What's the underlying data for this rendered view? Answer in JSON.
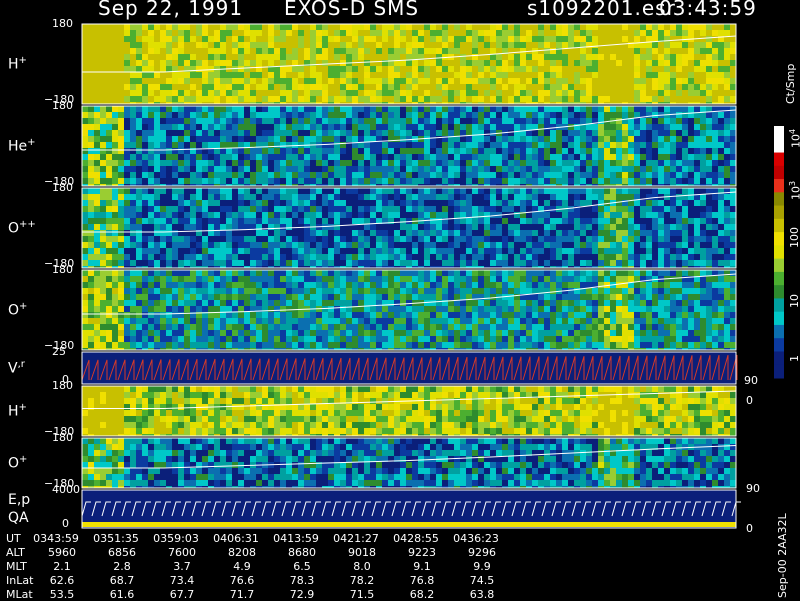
{
  "header": {
    "date": "Sep 22, 1991",
    "instrument": "EXOS-D SMS",
    "file": "s1092201.esr",
    "time": "03:43:59"
  },
  "colors": {
    "background": "#000000",
    "fill_blue": "#0b1f7a",
    "line": "#ffffff",
    "vel_line": "#d33a2a"
  },
  "panels": [
    {
      "label_main": "H",
      "label_sup": "+",
      "top_tick": "180",
      "bottom_tick": "−180",
      "type": "spectrogram",
      "level": 0.85,
      "curve": [
        0.6,
        0.6,
        0.55,
        0.5,
        0.45,
        0.38,
        0.3,
        0.22,
        0.15
      ]
    },
    {
      "label_main": "He",
      "label_sup": "+",
      "top_tick": "180",
      "bottom_tick": "−180",
      "type": "spectrogram",
      "level": 0.25,
      "curve": [
        0.55,
        0.55,
        0.52,
        0.48,
        0.42,
        0.35,
        0.25,
        0.12,
        0.05
      ]
    },
    {
      "label_main": "O",
      "label_sup": "++",
      "top_tick": "180",
      "bottom_tick": "−180",
      "type": "spectrogram",
      "level": 0.18,
      "curve": [
        0.55,
        0.55,
        0.52,
        0.48,
        0.42,
        0.35,
        0.25,
        0.12,
        0.05
      ]
    },
    {
      "label_main": "O",
      "label_sup": "+",
      "top_tick": "180",
      "bottom_tick": "−180",
      "type": "spectrogram",
      "level": 0.35,
      "curve": [
        0.55,
        0.55,
        0.52,
        0.48,
        0.42,
        0.35,
        0.25,
        0.12,
        0.05
      ]
    },
    {
      "label_main": "V",
      "label_sup": ",r",
      "top_tick": "25",
      "bottom_tick": "0",
      "type": "velocity",
      "right_top": "90",
      "right_bottom": "0"
    },
    {
      "label_main": "H",
      "label_sup": "+",
      "top_tick": "180",
      "bottom_tick": "−180",
      "type": "spectrogram",
      "level": 0.75,
      "curve": [
        0.45,
        0.45,
        0.4,
        0.35,
        0.3,
        0.25,
        0.2,
        0.15,
        0.1
      ]
    },
    {
      "label_main": "O",
      "label_sup": "+",
      "top_tick": "180",
      "bottom_tick": "−180",
      "type": "spectrogram",
      "level": 0.2,
      "curve": [
        0.6,
        0.6,
        0.55,
        0.5,
        0.45,
        0.38,
        0.3,
        0.22,
        0.15
      ],
      "right_bottom": "90"
    },
    {
      "label_main": "E,p",
      "label_sub": "QA",
      "top_tick": "4000",
      "bottom_tick": "0",
      "type": "energy",
      "right_bottom": "0"
    }
  ],
  "colorbar": {
    "title": "Ct/Smp",
    "labels": [
      {
        "text": "10",
        "sup": "4"
      },
      {
        "text": "10",
        "sup": "3"
      },
      {
        "text": "100",
        "sup": ""
      },
      {
        "text": "10",
        "sup": ""
      },
      {
        "text": "1",
        "sup": ""
      }
    ],
    "colors": [
      "#ffffff",
      "#ffffff",
      "#d90000",
      "#c00000",
      "#e8301b",
      "#888800",
      "#a8a000",
      "#c8c000",
      "#f0e000",
      "#e0e000",
      "#9acd32",
      "#4caf30",
      "#2e8b2e",
      "#00a0a0",
      "#00c8c8",
      "#0b6fb0",
      "#0b3aa0",
      "#0b1f7a",
      "#0b1f7a"
    ]
  },
  "footer_table": {
    "rows": [
      {
        "label": "UT",
        "values": [
          "0343:59",
          "0351:35",
          "0359:03",
          "0406:31",
          "0413:59",
          "0421:27",
          "0428:55",
          "0436:23"
        ]
      },
      {
        "label": "ALT",
        "values": [
          "5960",
          "6856",
          "7600",
          "8208",
          "8680",
          "9018",
          "9223",
          "9296"
        ]
      },
      {
        "label": "MLT",
        "values": [
          "2.1",
          "2.8",
          "3.7",
          "4.9",
          "6.5",
          "8.0",
          "9.1",
          "9.9"
        ]
      },
      {
        "label": "InLat",
        "values": [
          "62.6",
          "68.7",
          "73.4",
          "76.6",
          "78.3",
          "78.2",
          "76.8",
          "74.5"
        ]
      },
      {
        "label": "MLat",
        "values": [
          "53.5",
          "61.6",
          "67.7",
          "71.7",
          "72.9",
          "71.5",
          "68.2",
          "63.8"
        ]
      }
    ],
    "footnote": "Sep-00  2AA32L"
  },
  "chart_data": {
    "type": "heatmap",
    "title": "Sep 22, 1991   EXOS-D SMS   s1092201.esr   03:43:59",
    "x": [
      "0343:59",
      "0351:35",
      "0359:03",
      "0406:31",
      "0413:59",
      "0421:27",
      "0428:55",
      "0436:23"
    ],
    "series": [
      {
        "name": "H+",
        "ylim": [
          -180,
          180
        ]
      },
      {
        "name": "He+",
        "ylim": [
          -180,
          180
        ]
      },
      {
        "name": "O++",
        "ylim": [
          -180,
          180
        ]
      },
      {
        "name": "O+",
        "ylim": [
          -180,
          180
        ]
      },
      {
        "name": "V,r",
        "ylim": [
          0,
          25
        ]
      },
      {
        "name": "H+",
        "ylim": [
          -180,
          180
        ]
      },
      {
        "name": "O+",
        "ylim": [
          -180,
          180
        ]
      },
      {
        "name": "E,p QA",
        "ylim": [
          0,
          4000
        ]
      }
    ],
    "colorbar": {
      "label": "Ct/Smp",
      "ticks": [
        "1",
        "10",
        "100",
        "10^3",
        "10^4"
      ]
    }
  }
}
